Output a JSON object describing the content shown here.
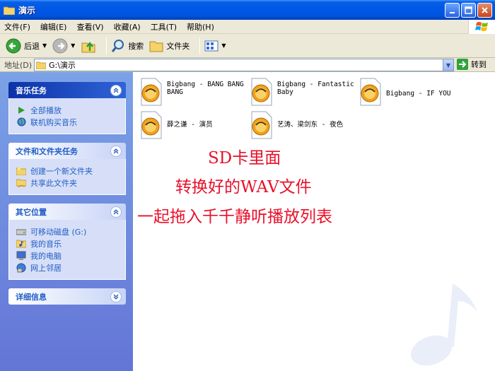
{
  "window": {
    "title": "演示"
  },
  "menu": {
    "items": [
      "文件(F)",
      "编辑(E)",
      "查看(V)",
      "收藏(A)",
      "工具(T)",
      "帮助(H)"
    ]
  },
  "toolbar": {
    "back_label": "后退",
    "search_label": "搜索",
    "folders_label": "文件夹"
  },
  "address": {
    "label": "地址(D)",
    "value": "G:\\演示",
    "go_label": "转到"
  },
  "sidebar": {
    "music_tasks": {
      "title": "音乐任务",
      "items": [
        "全部播放",
        "联机购买音乐"
      ]
    },
    "file_tasks": {
      "title": "文件和文件夹任务",
      "items": [
        "创建一个新文件夹",
        "共享此文件夹"
      ]
    },
    "other_places": {
      "title": "其它位置",
      "items": [
        "可移动磁盘 (G:)",
        "我的音乐",
        "我的电脑",
        "网上邻居"
      ]
    },
    "details": {
      "title": "详细信息"
    }
  },
  "files": [
    "Bigbang - BANG BANG BANG",
    "Bigbang - Fantastic Baby",
    "Bigbang - IF YOU",
    "薛之谦 - 演员",
    "艺涛、梁剑东 - 夜色"
  ],
  "annotations": [
    "SD卡里面",
    "转换好的WAV文件",
    "一起拖入千千静听播放列表"
  ],
  "colors": {
    "annotation": "#e8102a",
    "link": "#215dc6",
    "titlebar": "#0054dc"
  },
  "icons": {
    "folder": "folder-icon",
    "back": "back-arrow-icon",
    "forward": "forward-arrow-icon",
    "up": "folder-up-icon",
    "search": "search-icon",
    "views": "views-icon",
    "file": "wav-file-icon",
    "go": "go-arrow-icon"
  }
}
